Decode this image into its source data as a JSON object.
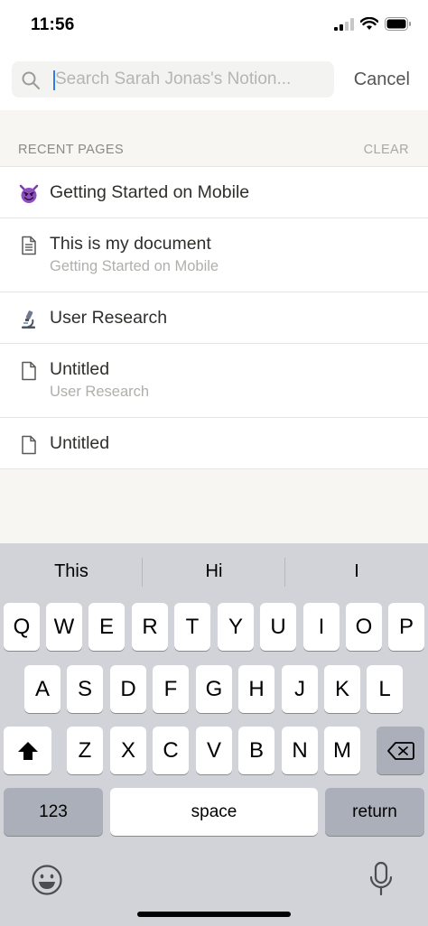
{
  "status_bar": {
    "time": "11:56"
  },
  "search": {
    "placeholder": "Search Sarah Jonas's Notion...",
    "value": "",
    "cancel_label": "Cancel"
  },
  "recent": {
    "title": "RECENT PAGES",
    "clear_label": "CLEAR",
    "items": [
      {
        "icon": "devil-emoji-icon",
        "title": "Getting Started on Mobile",
        "subtitle": ""
      },
      {
        "icon": "document-lines-icon",
        "title": "This is my document",
        "subtitle": "Getting Started on Mobile"
      },
      {
        "icon": "microscope-icon",
        "title": "User Research",
        "subtitle": ""
      },
      {
        "icon": "blank-page-icon",
        "title": "Untitled",
        "subtitle": "User Research"
      },
      {
        "icon": "blank-page-icon",
        "title": "Untitled",
        "subtitle": ""
      }
    ]
  },
  "keyboard": {
    "suggestions": [
      "This",
      "Hi",
      "I"
    ],
    "row1": [
      "Q",
      "W",
      "E",
      "R",
      "T",
      "Y",
      "U",
      "I",
      "O",
      "P"
    ],
    "row2": [
      "A",
      "S",
      "D",
      "F",
      "G",
      "H",
      "J",
      "K",
      "L"
    ],
    "row3": [
      "Z",
      "X",
      "C",
      "V",
      "B",
      "N",
      "M"
    ],
    "numbers_label": "123",
    "space_label": "space",
    "return_label": "return"
  }
}
